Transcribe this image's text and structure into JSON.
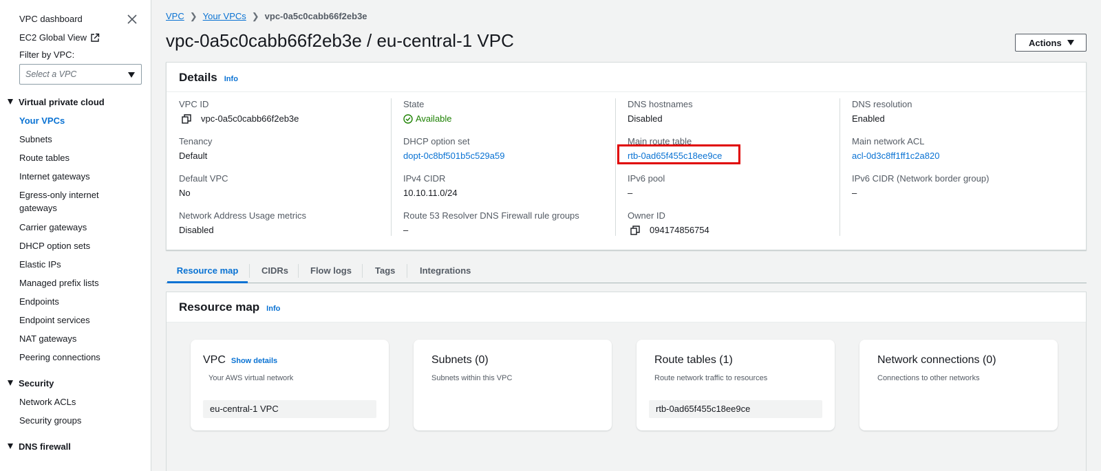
{
  "sidebar": {
    "top_links": [
      {
        "label": "VPC dashboard"
      },
      {
        "label": "EC2 Global View"
      }
    ],
    "filter_label": "Filter by VPC:",
    "filter_placeholder": "Select a VPC",
    "sections": [
      {
        "title": "Virtual private cloud",
        "items": [
          "Your VPCs",
          "Subnets",
          "Route tables",
          "Internet gateways",
          "Egress-only internet",
          "gateways",
          "Carrier gateways",
          "DHCP option sets",
          "Elastic IPs",
          "Managed prefix lists",
          "Endpoints",
          "Endpoint services",
          "NAT gateways",
          "Peering connections"
        ]
      },
      {
        "title": "Security",
        "items": [
          "Network ACLs",
          "Security groups"
        ]
      },
      {
        "title": "DNS firewall",
        "items": []
      }
    ],
    "active_item": "Your VPCs"
  },
  "breadcrumb": {
    "root": "VPC",
    "parent": "Your VPCs",
    "current": "vpc-0a5c0cabb66f2eb3e"
  },
  "page": {
    "title": "vpc-0a5c0cabb66f2eb3e / eu-central-1 VPC",
    "actions_label": "Actions"
  },
  "details": {
    "heading": "Details",
    "info": "Info",
    "columns": [
      [
        {
          "key": "VPC ID",
          "value": "vpc-0a5c0cabb66f2eb3e"
        },
        {
          "key": "Tenancy",
          "value": "Default"
        },
        {
          "key": "Default VPC",
          "value": "No"
        },
        {
          "key": "Network Address Usage metrics",
          "value": "Disabled"
        }
      ],
      [
        {
          "key": "State",
          "value": "Available"
        },
        {
          "key": "DHCP option set",
          "value": "dopt-0c8bf501b5c529a59"
        },
        {
          "key": "IPv4 CIDR",
          "value": "10.10.11.0/24"
        },
        {
          "key": "Route 53 Resolver DNS Firewall rule groups",
          "value": "–"
        }
      ],
      [
        {
          "key": "DNS hostnames",
          "value": "Disabled"
        },
        {
          "key": "Main route table",
          "value": "rtb-0ad65f455c18ee9ce"
        },
        {
          "key": "IPv6 pool",
          "value": "–"
        },
        {
          "key": "Owner ID",
          "value": "094174856754"
        }
      ],
      [
        {
          "key": "DNS resolution",
          "value": "Enabled"
        },
        {
          "key": "Main network ACL",
          "value": "acl-0d3c8ff1ff1c2a820"
        },
        {
          "key": "IPv6 CIDR (Network border group)",
          "value": "–"
        }
      ]
    ]
  },
  "tabs": [
    "Resource map",
    "CIDRs",
    "Flow logs",
    "Tags",
    "Integrations"
  ],
  "resource_map": {
    "heading": "Resource map",
    "info": "Info",
    "cards": [
      {
        "title": "VPC",
        "link": "Show details",
        "subtitle": "Your AWS virtual network",
        "chip": "eu-central-1 VPC"
      },
      {
        "title": "Subnets (0)",
        "subtitle": "Subnets within this VPC"
      },
      {
        "title": "Route tables (1)",
        "subtitle": "Route network traffic to resources",
        "chip": "rtb-0ad65f455c18ee9ce"
      },
      {
        "title": "Network connections (0)",
        "subtitle": "Connections to other networks"
      }
    ]
  },
  "colors": {
    "link": "#0972d3",
    "success": "#1d8102",
    "highlight": "#e00000"
  }
}
